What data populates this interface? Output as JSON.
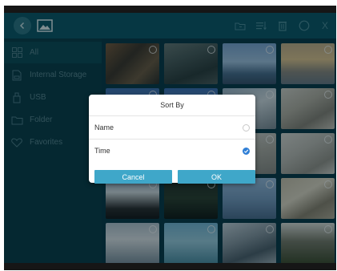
{
  "sidebar": {
    "items": [
      {
        "label": "All",
        "icon": "grid-icon"
      },
      {
        "label": "Internal Storage",
        "icon": "sd-card-icon"
      },
      {
        "label": "USB",
        "icon": "usb-icon"
      },
      {
        "label": "Folder",
        "icon": "folder-icon"
      },
      {
        "label": "Favorites",
        "icon": "heart-icon"
      }
    ]
  },
  "toolbar": {
    "close_label": "X",
    "icons": [
      "back-arrow-icon",
      "image-icon",
      "folder-icon",
      "sort-icon",
      "delete-icon",
      "select-circle-icon",
      "close-icon"
    ]
  },
  "dialog": {
    "title": "Sort By",
    "options": [
      {
        "label": "Name",
        "selected": false
      },
      {
        "label": "Time",
        "selected": true
      }
    ],
    "cancel_label": "Cancel",
    "ok_label": "OK"
  },
  "colors": {
    "toolbar": "#0c5766",
    "sidebar": "#0a3b46",
    "accent": "#3fa7c9",
    "radio_selected": "#2f7fd6"
  }
}
